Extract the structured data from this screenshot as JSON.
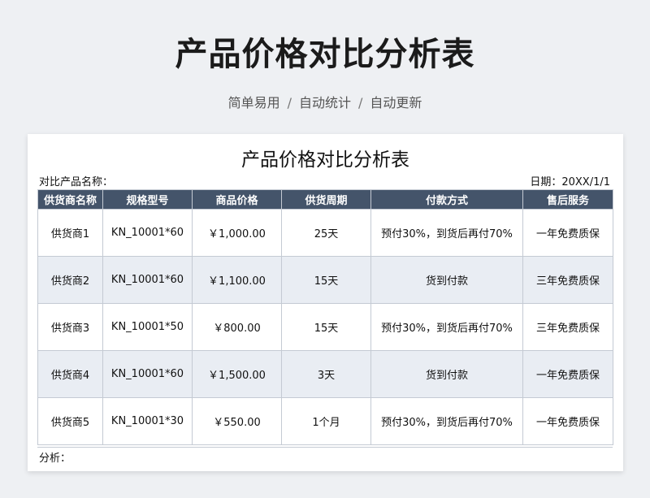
{
  "header": {
    "title": "产品价格对比分析表",
    "subtitle_parts": [
      "简单易用",
      "自动统计",
      "自动更新"
    ],
    "separator": "/"
  },
  "sheet": {
    "title": "产品价格对比分析表",
    "product_label": "对比产品名称：",
    "date_label": "日期：20XX/1/1",
    "columns": [
      "供货商名称",
      "规格型号",
      "商品价格",
      "供货周期",
      "付款方式",
      "售后服务"
    ],
    "rows": [
      [
        "供货商1",
        "KN_10001*60",
        "￥1,000.00",
        "25天",
        "预付30%，到货后再付70%",
        "一年免费质保"
      ],
      [
        "供货商2",
        "KN_10001*60",
        "￥1,100.00",
        "15天",
        "货到付款",
        "三年免费质保"
      ],
      [
        "供货商3",
        "KN_10001*50",
        "￥800.00",
        "15天",
        "预付30%，到货后再付70%",
        "三年免费质保"
      ],
      [
        "供货商4",
        "KN_10001*60",
        "￥1,500.00",
        "3天",
        "货到付款",
        "一年免费质保"
      ],
      [
        "供货商5",
        "KN_10001*30",
        "￥550.00",
        "1个月",
        "预付30%，到货后再付70%",
        "一年免费质保"
      ]
    ],
    "analysis_label": "分析："
  },
  "colors": {
    "header_bg": "#44546a",
    "stripe_bg": "#e9edf3",
    "page_bg": "#eef0f3"
  }
}
